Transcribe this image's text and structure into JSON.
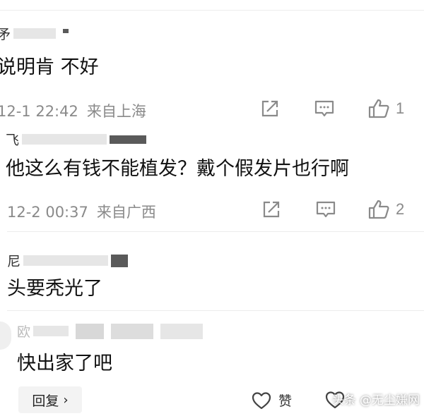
{
  "comments": [
    {
      "name": "矛",
      "text": "说明肯 不好",
      "time": "12-1 22:42",
      "location": "来自上海",
      "likes": "1"
    },
    {
      "name": "飞",
      "text": "他这么有钱不能植发？戴个假发片也行啊",
      "time": "12-2 00:37",
      "location": "来自广西",
      "likes": "2"
    },
    {
      "name": "尼",
      "text": "头要秃光了"
    },
    {
      "name": "欧",
      "text": "快出家了吧",
      "reply_label": "回复",
      "reply_chevron": "›",
      "like_label": "赞"
    }
  ],
  "watermark": "头条 @无尘嫌网",
  "icons": {
    "share": "share-icon",
    "comment": "comment-icon",
    "like": "thumbs-up-icon",
    "heart": "heart-icon"
  },
  "colors": {
    "meta_text": "#8a8a8a",
    "divider": "#ececec"
  }
}
